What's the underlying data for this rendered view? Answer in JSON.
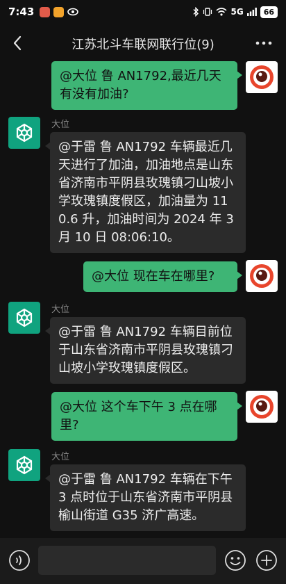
{
  "status_bar": {
    "time": "7:43",
    "app_icon_colors": [
      "#e25b4a",
      "#f2a32b"
    ],
    "signal_text": "5G",
    "battery": "66"
  },
  "header": {
    "title": "江苏北斗车联网联行位(9)",
    "back_icon": "chevron-left-icon",
    "more_icon": "more-dots-icon"
  },
  "colors": {
    "outgoing_bubble": "#3eb575",
    "incoming_bubble": "#2b2b2b",
    "background": "#111111",
    "bot_avatar": "#10a37f"
  },
  "messages": [
    {
      "direction": "out",
      "text": "@大位 鲁 AN1792,最近几天有没有加油?"
    },
    {
      "direction": "in",
      "sender": "大位",
      "text": "@于雷 鲁 AN1792 车辆最近几天进行了加油，加油地点是山东省济南市平阴县玫瑰镇刁山坡小学玫瑰镇度假区，加油量为 110.6 升，加油时间为 2024 年 3 月 10 日 08:06:10。"
    },
    {
      "direction": "out",
      "text": "@大位  现在车在哪里?"
    },
    {
      "direction": "in",
      "sender": "大位",
      "text": "@于雷 鲁 AN1792 车辆目前位于山东省济南市平阴县玫瑰镇刁山坡小学玫瑰镇度假区。"
    },
    {
      "direction": "out",
      "text": "@大位  这个车下午 3 点在哪里?"
    },
    {
      "direction": "in",
      "sender": "大位",
      "text": "@于雷 鲁 AN1792 车辆在下午 3 点时位于山东省济南市平阴县榆山街道 G35 济广高速。"
    }
  ],
  "input_bar": {
    "voice_icon": "voice-icon",
    "emoji_icon": "emoji-icon",
    "plus_icon": "plus-icon",
    "value": ""
  }
}
